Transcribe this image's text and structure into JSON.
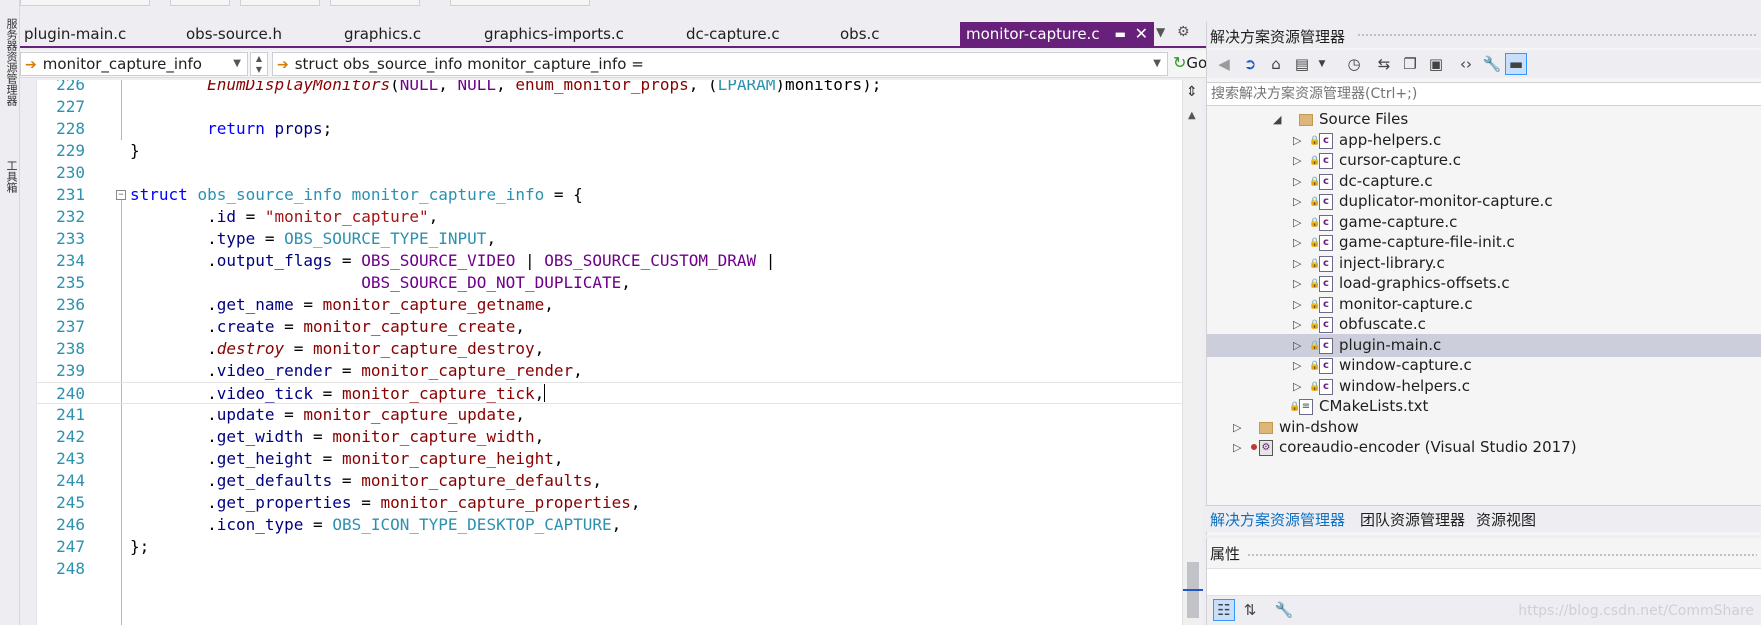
{
  "side_tabs": [
    "服务器资源管理器",
    "工具箱"
  ],
  "editor_tabs": [
    {
      "label": "plugin-main.c"
    },
    {
      "label": "obs-source.h"
    },
    {
      "label": "graphics.c"
    },
    {
      "label": "graphics-imports.c"
    },
    {
      "label": "dc-capture.c"
    },
    {
      "label": "obs.c"
    },
    {
      "label": "monitor-capture.c",
      "active": true
    }
  ],
  "icons": {
    "tab_pin": "pin-icon",
    "tab_close": "close-icon",
    "tab_dropdown": "chevron-down-icon",
    "settings": "gear-icon",
    "go": "go-icon"
  },
  "nav_bar": {
    "scope": "monitor_capture_info",
    "member": "struct obs_source_info monitor_capture_info =",
    "go_label": "Go"
  },
  "code_lines": [
    {
      "num": "226",
      "tokens": [
        {
          "t": "        "
        },
        {
          "t": "EnumDisplayMonitors",
          "c": "fnit"
        },
        {
          "t": "("
        },
        {
          "t": "NULL",
          "c": "mac"
        },
        {
          "t": ", "
        },
        {
          "t": "NULL",
          "c": "mac"
        },
        {
          "t": ", "
        },
        {
          "t": "enum_monitor_props",
          "c": "fn"
        },
        {
          "t": ", ("
        },
        {
          "t": "LPARAM",
          "c": "type"
        },
        {
          "t": ")monitors);"
        }
      ]
    },
    {
      "num": "227",
      "tokens": []
    },
    {
      "num": "228",
      "tokens": [
        {
          "t": "        "
        },
        {
          "t": "return",
          "c": "kw"
        },
        {
          "t": " "
        },
        {
          "t": "props",
          "c": "prop"
        },
        {
          "t": ";"
        }
      ]
    },
    {
      "num": "229",
      "tokens": [
        {
          "t": "}"
        }
      ]
    },
    {
      "num": "230",
      "tokens": []
    },
    {
      "num": "231",
      "fold": true,
      "tokens": [
        {
          "t": "struct",
          "c": "kw"
        },
        {
          "t": " "
        },
        {
          "t": "obs_source_info",
          "c": "type"
        },
        {
          "t": " "
        },
        {
          "t": "monitor_capture_info",
          "c": "type"
        },
        {
          "t": " = {"
        }
      ]
    },
    {
      "num": "232",
      "tokens": [
        {
          "t": "        ."
        },
        {
          "t": "id",
          "c": "prop"
        },
        {
          "t": " = "
        },
        {
          "t": "\"monitor_capture\"",
          "c": "str"
        },
        {
          "t": ","
        }
      ]
    },
    {
      "num": "233",
      "tokens": [
        {
          "t": "        ."
        },
        {
          "t": "type",
          "c": "prop"
        },
        {
          "t": " = "
        },
        {
          "t": "OBS_SOURCE_TYPE_INPUT",
          "c": "type"
        },
        {
          "t": ","
        }
      ]
    },
    {
      "num": "234",
      "tokens": [
        {
          "t": "        ."
        },
        {
          "t": "output_flags",
          "c": "prop"
        },
        {
          "t": " = "
        },
        {
          "t": "OBS_SOURCE_VIDEO",
          "c": "mac"
        },
        {
          "t": " | "
        },
        {
          "t": "OBS_SOURCE_CUSTOM_DRAW",
          "c": "mac"
        },
        {
          "t": " |"
        }
      ]
    },
    {
      "num": "235",
      "tokens": [
        {
          "t": "                        "
        },
        {
          "t": "OBS_SOURCE_DO_NOT_DUPLICATE",
          "c": "mac"
        },
        {
          "t": ","
        }
      ]
    },
    {
      "num": "236",
      "tokens": [
        {
          "t": "        ."
        },
        {
          "t": "get_name",
          "c": "prop"
        },
        {
          "t": " = "
        },
        {
          "t": "monitor_capture_getname",
          "c": "fn"
        },
        {
          "t": ","
        }
      ]
    },
    {
      "num": "237",
      "tokens": [
        {
          "t": "        ."
        },
        {
          "t": "create",
          "c": "prop"
        },
        {
          "t": " = "
        },
        {
          "t": "monitor_capture_create",
          "c": "fn"
        },
        {
          "t": ","
        }
      ]
    },
    {
      "num": "238",
      "tokens": [
        {
          "t": "        ."
        },
        {
          "t": "destroy",
          "c": "fnit"
        },
        {
          "t": " = "
        },
        {
          "t": "monitor_capture_destroy",
          "c": "fn"
        },
        {
          "t": ","
        }
      ]
    },
    {
      "num": "239",
      "tokens": [
        {
          "t": "        ."
        },
        {
          "t": "video_render",
          "c": "prop"
        },
        {
          "t": " = "
        },
        {
          "t": "monitor_capture_render",
          "c": "fn"
        },
        {
          "t": ","
        }
      ]
    },
    {
      "num": "240",
      "current": true,
      "tokens": [
        {
          "t": "        ."
        },
        {
          "t": "video_tick",
          "c": "prop"
        },
        {
          "t": " = "
        },
        {
          "t": "monitor_capture_tick",
          "c": "fn"
        },
        {
          "t": ","
        }
      ]
    },
    {
      "num": "241",
      "tokens": [
        {
          "t": "        ."
        },
        {
          "t": "update",
          "c": "prop"
        },
        {
          "t": " = "
        },
        {
          "t": "monitor_capture_update",
          "c": "fn"
        },
        {
          "t": ","
        }
      ]
    },
    {
      "num": "242",
      "tokens": [
        {
          "t": "        ."
        },
        {
          "t": "get_width",
          "c": "prop"
        },
        {
          "t": " = "
        },
        {
          "t": "monitor_capture_width",
          "c": "fn"
        },
        {
          "t": ","
        }
      ]
    },
    {
      "num": "243",
      "tokens": [
        {
          "t": "        ."
        },
        {
          "t": "get_height",
          "c": "prop"
        },
        {
          "t": " = "
        },
        {
          "t": "monitor_capture_height",
          "c": "fn"
        },
        {
          "t": ","
        }
      ]
    },
    {
      "num": "244",
      "tokens": [
        {
          "t": "        ."
        },
        {
          "t": "get_defaults",
          "c": "prop"
        },
        {
          "t": " = "
        },
        {
          "t": "monitor_capture_defaults",
          "c": "fn"
        },
        {
          "t": ","
        }
      ]
    },
    {
      "num": "245",
      "tokens": [
        {
          "t": "        ."
        },
        {
          "t": "get_properties",
          "c": "prop"
        },
        {
          "t": " = "
        },
        {
          "t": "monitor_capture_properties",
          "c": "fn"
        },
        {
          "t": ","
        }
      ]
    },
    {
      "num": "246",
      "tokens": [
        {
          "t": "        ."
        },
        {
          "t": "icon_type",
          "c": "prop"
        },
        {
          "t": " = "
        },
        {
          "t": "OBS_ICON_TYPE_DESKTOP_CAPTURE",
          "c": "type"
        },
        {
          "t": ","
        }
      ]
    },
    {
      "num": "247",
      "tokens": [
        {
          "t": "};"
        }
      ]
    },
    {
      "num": "248",
      "tokens": []
    }
  ],
  "solution_explorer": {
    "title": "解决方案资源管理器",
    "search_placeholder": "搜索解决方案资源管理器(Ctrl+;)",
    "toolbar_icons": [
      "back-icon",
      "forward-icon",
      "home-icon",
      "switch-view-icon",
      "pending-changes-icon",
      "sync-icon",
      "collapse-all-icon",
      "show-all-files-icon",
      "view-code-icon",
      "properties-wrench-icon",
      "preview-icon"
    ],
    "tree": [
      {
        "label": "Source Files",
        "kind": "folder",
        "level": 1,
        "arrow": "◢"
      },
      {
        "label": "app-helpers.c",
        "kind": "c",
        "level": 2,
        "arrow": "▷",
        "lock": true
      },
      {
        "label": "cursor-capture.c",
        "kind": "c",
        "level": 2,
        "arrow": "▷",
        "lock": true
      },
      {
        "label": "dc-capture.c",
        "kind": "c",
        "level": 2,
        "arrow": "▷",
        "lock": true
      },
      {
        "label": "duplicator-monitor-capture.c",
        "kind": "c",
        "level": 2,
        "arrow": "▷",
        "lock": true
      },
      {
        "label": "game-capture.c",
        "kind": "c",
        "level": 2,
        "arrow": "▷",
        "lock": true
      },
      {
        "label": "game-capture-file-init.c",
        "kind": "c",
        "level": 2,
        "arrow": "▷",
        "lock": true
      },
      {
        "label": "inject-library.c",
        "kind": "c",
        "level": 2,
        "arrow": "▷",
        "lock": true
      },
      {
        "label": "load-graphics-offsets.c",
        "kind": "c",
        "level": 2,
        "arrow": "▷",
        "lock": true
      },
      {
        "label": "monitor-capture.c",
        "kind": "c",
        "level": 2,
        "arrow": "▷",
        "lock": true
      },
      {
        "label": "obfuscate.c",
        "kind": "c",
        "level": 2,
        "arrow": "▷",
        "lock": true
      },
      {
        "label": "plugin-main.c",
        "kind": "c",
        "level": 2,
        "arrow": "▷",
        "lock": true,
        "selected": true
      },
      {
        "label": "window-capture.c",
        "kind": "c",
        "level": 2,
        "arrow": "▷",
        "lock": true
      },
      {
        "label": "window-helpers.c",
        "kind": "c",
        "level": 2,
        "arrow": "▷",
        "lock": true
      },
      {
        "label": "CMakeLists.txt",
        "kind": "doc",
        "level": 1,
        "arrow": "",
        "lock": true
      },
      {
        "label": "win-dshow",
        "kind": "folder",
        "level": 0,
        "arrow": "▷"
      },
      {
        "label": "coreaudio-encoder (Visual Studio 2017)",
        "kind": "proj",
        "level": 0,
        "arrow": "▷",
        "error": true
      }
    ],
    "bottom_tabs": [
      {
        "label": "解决方案资源管理器",
        "active": true
      },
      {
        "label": "团队资源管理器"
      },
      {
        "label": "资源视图"
      }
    ]
  },
  "properties": {
    "title": "属性",
    "toolbar_icons": [
      "categorized-icon",
      "alphabetical-icon",
      "property-pages-icon"
    ]
  },
  "watermark": "https://blog.csdn.net/CommShare",
  "colors": {
    "active_tab": "#68217a",
    "keyword": "#0000ff",
    "type": "#2b91af",
    "string": "#a31515",
    "macro": "#6f008a",
    "function": "#880000",
    "line_number": "#2b91af",
    "selected_row": "#cccedb",
    "link_tab": "#0e70c0"
  }
}
